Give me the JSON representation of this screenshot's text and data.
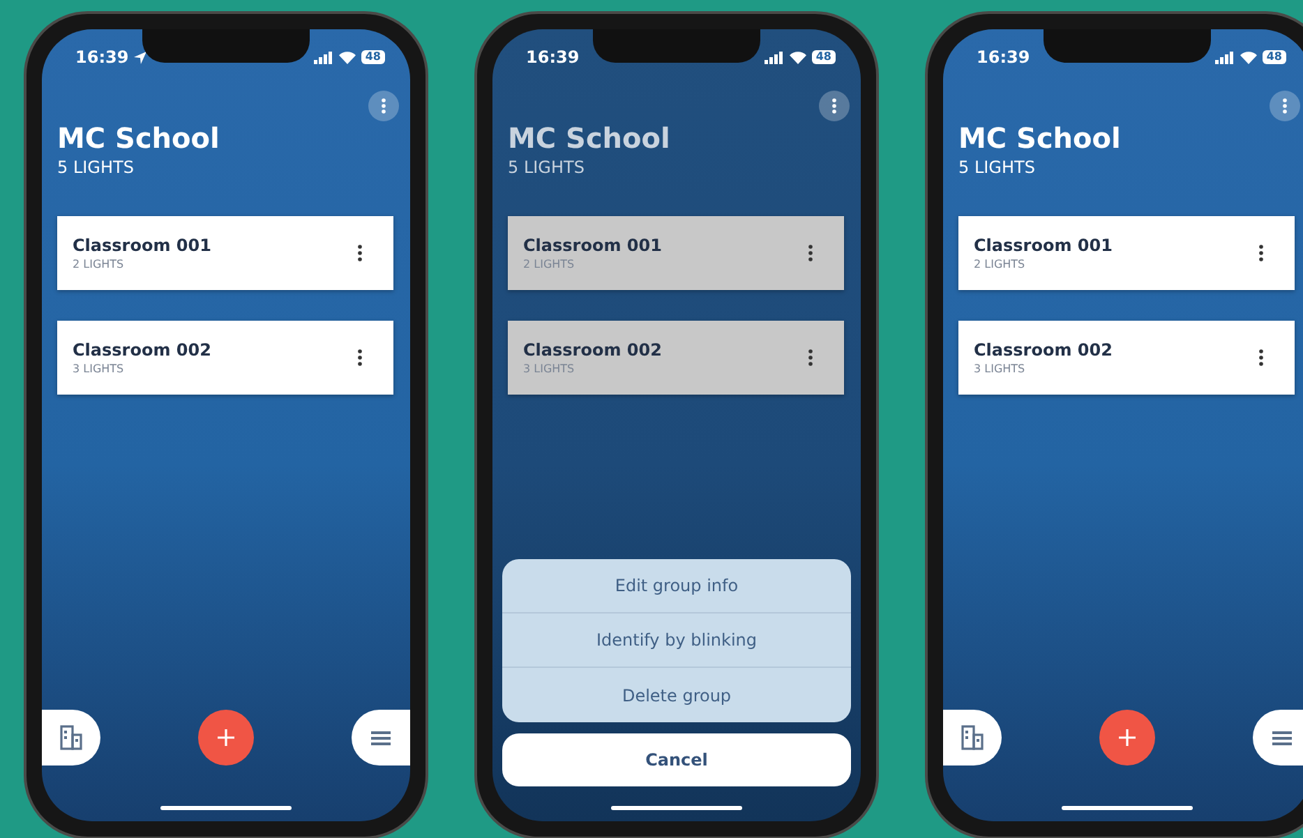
{
  "phones": [
    {
      "status": {
        "time": "16:39",
        "location_arrow": true,
        "battery": "48"
      },
      "title": "MC School",
      "subtitle": "5 LIGHTS",
      "dimmed": false,
      "groups": [
        {
          "name": "Classroom 001",
          "count": "2 LIGHTS"
        },
        {
          "name": "Classroom 002",
          "count": "3 LIGHTS"
        }
      ]
    },
    {
      "status": {
        "time": "16:39",
        "location_arrow": false,
        "battery": "48"
      },
      "title": "MC School",
      "subtitle": "5 LIGHTS",
      "dimmed": true,
      "groups": [
        {
          "name": "Classroom 001",
          "count": "2 LIGHTS"
        },
        {
          "name": "Classroom 002",
          "count": "3 LIGHTS"
        }
      ],
      "action_sheet": {
        "actions": [
          "Edit group info",
          "Identify by blinking",
          "Delete group"
        ],
        "cancel": "Cancel"
      }
    },
    {
      "status": {
        "time": "16:39",
        "location_arrow": false,
        "battery": "48"
      },
      "title": "MC School",
      "subtitle": "5 LIGHTS",
      "dimmed": false,
      "groups": [
        {
          "name": "Classroom 001",
          "count": "2 LIGHTS"
        },
        {
          "name": "Classroom 002",
          "count": "3 LIGHTS"
        }
      ]
    }
  ]
}
